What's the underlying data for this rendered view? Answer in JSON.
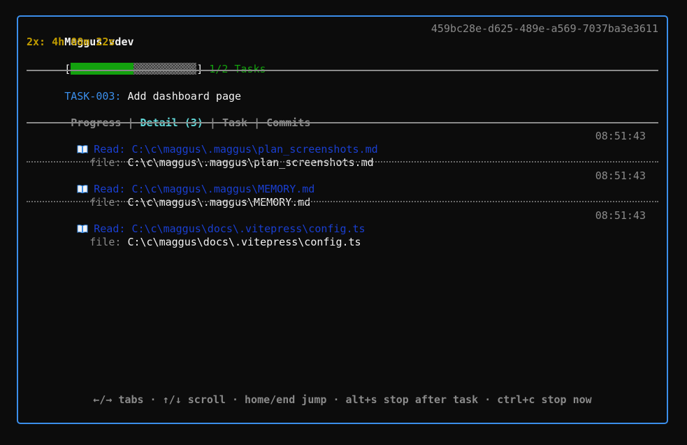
{
  "header": {
    "app_name": "Maggus vdev",
    "session_id": "459bc28e-d625-489e-a569-7037ba3e3611",
    "elapsed": "2x: 4h 08m 22s",
    "progress": {
      "fraction": 0.5,
      "open_bracket": "[",
      "close_bracket": "]",
      "label": "1/2 Tasks"
    }
  },
  "task": {
    "id": "TASK-003:",
    "title": "Add dashboard page"
  },
  "tabs": [
    {
      "label": "Progress",
      "active": false
    },
    {
      "label": "Detail (3)",
      "active": true
    },
    {
      "label": "Task",
      "active": false
    },
    {
      "label": "Commits",
      "active": false
    }
  ],
  "tab_separator": "|",
  "entries": [
    {
      "icon": "book-icon",
      "action": "Read:",
      "path": "C:\\c\\maggus\\.maggus\\plan_screenshots.md",
      "time": "08:51:43",
      "detail_key": "file:",
      "detail_value": "C:\\c\\maggus\\.maggus\\plan_screenshots.md"
    },
    {
      "icon": "book-icon",
      "action": "Read:",
      "path": "C:\\c\\maggus\\.maggus\\MEMORY.md",
      "time": "08:51:43",
      "detail_key": "file:",
      "detail_value": "C:\\c\\maggus\\.maggus\\MEMORY.md"
    },
    {
      "icon": "book-icon",
      "action": "Read:",
      "path": "C:\\c\\maggus\\docs\\.vitepress\\config.ts",
      "time": "08:51:43",
      "detail_key": "file:",
      "detail_value": "C:\\c\\maggus\\docs\\.vitepress\\config.ts"
    }
  ],
  "footer": {
    "hint": "←/→ tabs · ↑/↓ scroll · home/end jump · alt+s stop after task · ctrl+c stop now"
  },
  "colors": {
    "border": "#3b8eea",
    "accent_green": "#13a10e",
    "elapsed_yellow": "#c19c00",
    "task_id_blue": "#3b8eea",
    "active_tab_cyan": "#61d6d6",
    "entry_blue": "#1a3fd1"
  }
}
